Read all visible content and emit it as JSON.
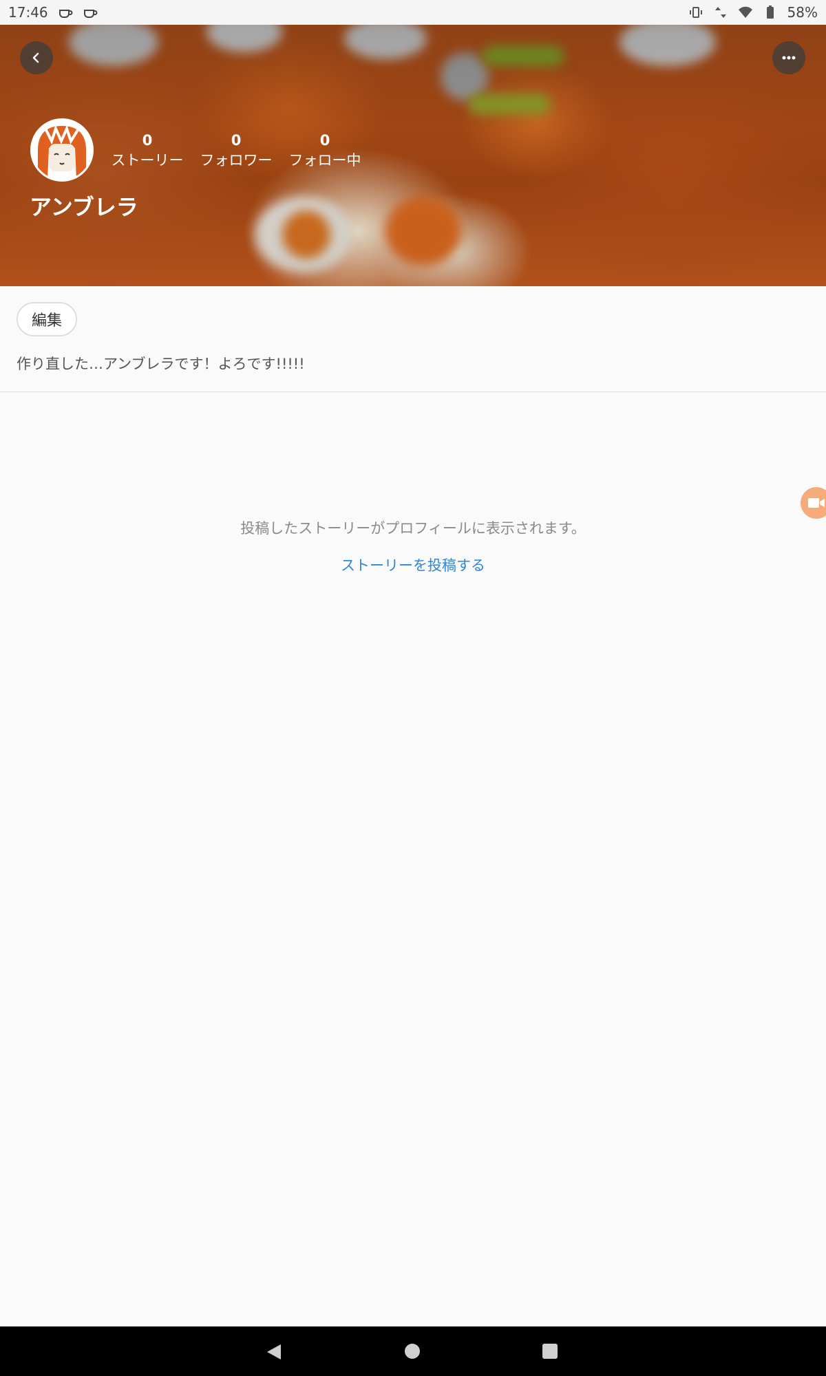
{
  "status_bar": {
    "time": "17:46",
    "battery": "58%",
    "icons": [
      "coffee-icon",
      "coffee-icon",
      "vibrate-icon",
      "data-arrows-icon",
      "wifi-icon",
      "battery-icon"
    ]
  },
  "header": {
    "back_icon": "chevron-left-icon",
    "more_icon": "more-horizontal-icon",
    "avatar_icon": "avatar-image",
    "username": "アンブレラ",
    "stats": {
      "stories": {
        "value": "0",
        "label": "ストーリー"
      },
      "followers": {
        "value": "0",
        "label": "フォロワー"
      },
      "following": {
        "value": "0",
        "label": "フォロー中"
      }
    }
  },
  "profile": {
    "edit_label": "編集",
    "bio": "作り直した…アンブレラです！よろです!!!!!"
  },
  "empty_state": {
    "message": "投稿したストーリーがプロフィールに表示されます。",
    "link_label": "ストーリーを投稿する"
  },
  "floating_button": {
    "icon": "video-camera-icon"
  },
  "nav_bar": {
    "icons": [
      "nav-back-icon",
      "nav-home-icon",
      "nav-recents-icon"
    ]
  },
  "colors": {
    "accent_link": "#2e86d6",
    "banner_orange": "#b0501a",
    "floating_button": "#f6ab7a"
  }
}
